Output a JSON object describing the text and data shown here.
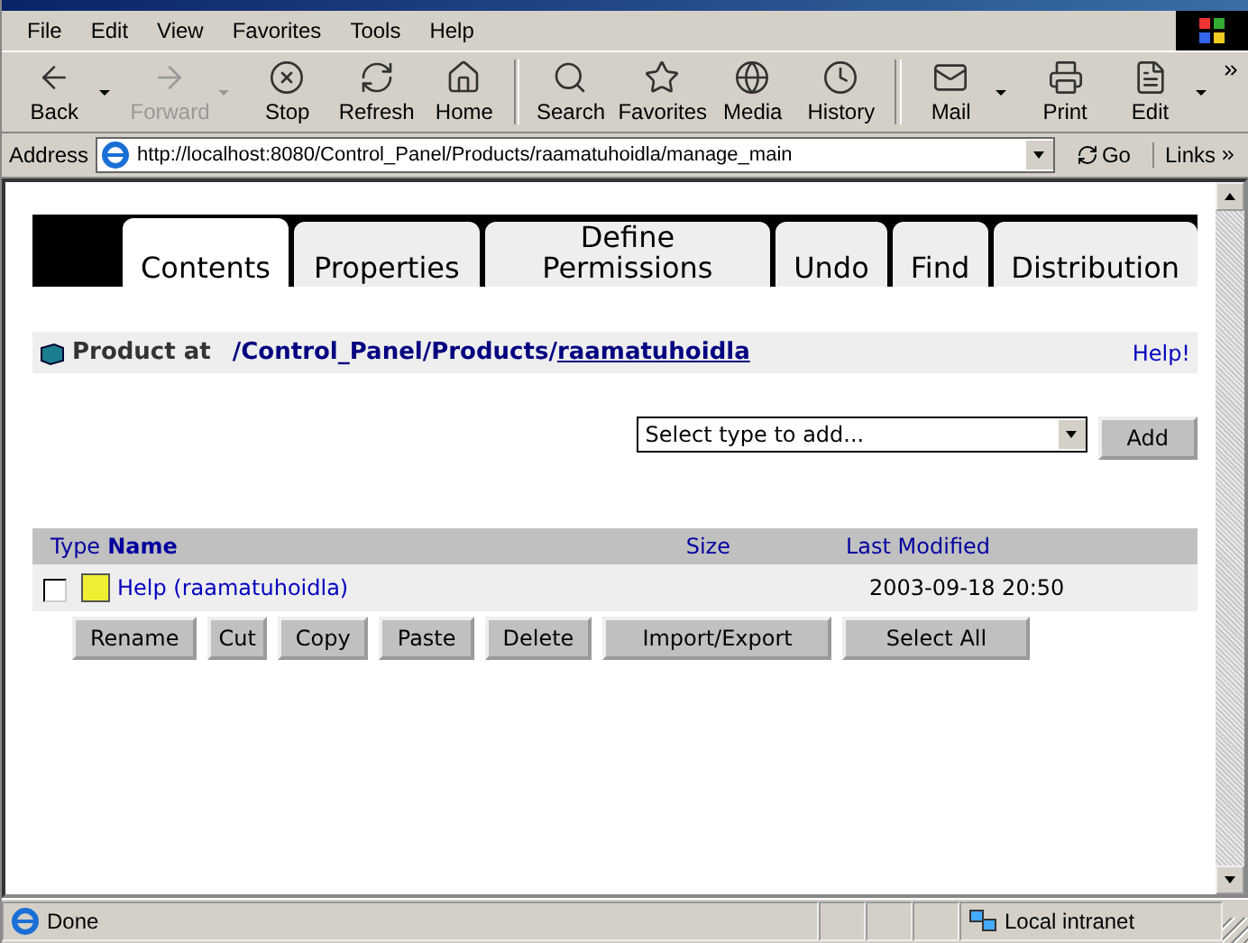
{
  "menu": [
    "File",
    "Edit",
    "View",
    "Favorites",
    "Tools",
    "Help"
  ],
  "toolbar": [
    {
      "kind": "back",
      "label": "Back",
      "disabled": false,
      "dropdown": true
    },
    {
      "kind": "forward",
      "label": "Forward",
      "disabled": true,
      "dropdown": true
    },
    {
      "kind": "stop",
      "label": "Stop",
      "disabled": false,
      "dropdown": false
    },
    {
      "kind": "refresh",
      "label": "Refresh",
      "disabled": false,
      "dropdown": false
    },
    {
      "kind": "home",
      "label": "Home",
      "disabled": false,
      "dropdown": false
    },
    {
      "kind": "search",
      "label": "Search",
      "disabled": false,
      "dropdown": false
    },
    {
      "kind": "favorites",
      "label": "Favorites",
      "disabled": false,
      "dropdown": false
    },
    {
      "kind": "media",
      "label": "Media",
      "disabled": false,
      "dropdown": false
    },
    {
      "kind": "history",
      "label": "History",
      "disabled": false,
      "dropdown": false
    },
    {
      "kind": "mail",
      "label": "Mail",
      "disabled": false,
      "dropdown": true
    },
    {
      "kind": "print",
      "label": "Print",
      "disabled": false,
      "dropdown": false
    },
    {
      "kind": "edit",
      "label": "Edit",
      "disabled": false,
      "dropdown": true
    }
  ],
  "address": {
    "label": "Address",
    "value": "http://localhost:8080/Control_Panel/Products/raamatuhoidla/manage_main",
    "go": "Go",
    "links": "Links"
  },
  "tabs": [
    {
      "label": "Contents",
      "selected": true
    },
    {
      "label": "Properties",
      "selected": false
    },
    {
      "label": "Define Permissions",
      "selected": false
    },
    {
      "label": "Undo",
      "selected": false
    },
    {
      "label": "Find",
      "selected": false
    },
    {
      "label": "Distribution",
      "selected": false
    }
  ],
  "location": {
    "prefix": "Product at",
    "path": [
      "/Control_Panel",
      "/Products",
      "/"
    ],
    "current": "raamatuhoidla",
    "help": "Help!"
  },
  "add": {
    "placeholder": "Select type to add...",
    "button": "Add"
  },
  "table": {
    "columns": [
      "Type",
      "Name",
      "Size",
      "Last Modified"
    ],
    "rows": [
      {
        "name": "Help (raamatuhoidla)",
        "size": "",
        "modified": "2003-09-18 20:50",
        "checked": false
      }
    ]
  },
  "actions": [
    "Rename",
    "Cut",
    "Copy",
    "Paste",
    "Delete",
    "Import/Export",
    "Select All"
  ],
  "status": {
    "text": "Done",
    "zone": "Local intranet"
  }
}
